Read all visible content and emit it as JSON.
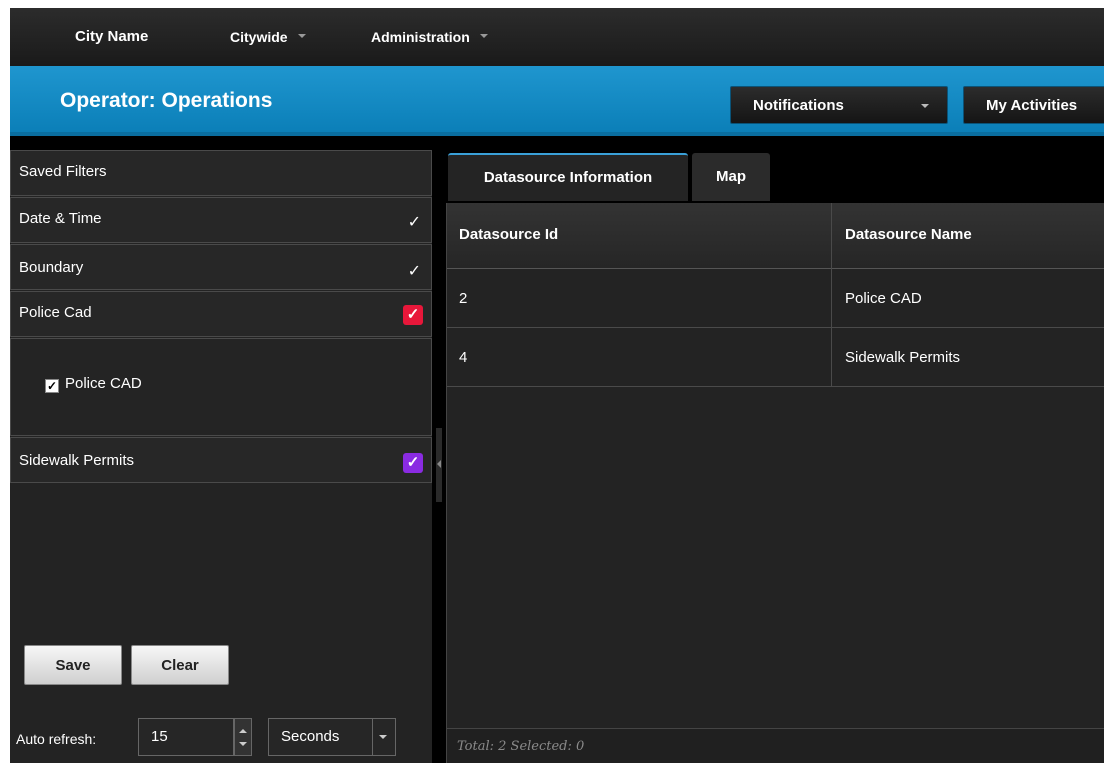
{
  "topnav": {
    "brand": "City Name",
    "menus": [
      "Citywide",
      "Administration"
    ]
  },
  "header": {
    "title": "Operator: Operations",
    "notifications_label": "Notifications",
    "activities_label": "My Activities"
  },
  "filters": {
    "saved_filters_label": "Saved Filters",
    "items": [
      {
        "label": "Date & Time",
        "checked": true
      },
      {
        "label": "Boundary",
        "checked": true
      },
      {
        "label": "Police Cad",
        "checked": true,
        "color": "#e8173a"
      },
      {
        "label": "Sidewalk Permits",
        "checked": true,
        "color": "#8a2be2"
      }
    ],
    "police_sub_option": "Police CAD",
    "check_glyph": "✓",
    "save_label": "Save",
    "clear_label": "Clear",
    "auto_refresh_label": "Auto refresh:",
    "auto_refresh_value": "15",
    "auto_refresh_unit": "Seconds"
  },
  "tabs": [
    "Datasource Information",
    "Map"
  ],
  "table": {
    "columns": [
      "Datasource Id",
      "Datasource Name"
    ],
    "rows": [
      {
        "id": "2",
        "name": "Police CAD"
      },
      {
        "id": "4",
        "name": "Sidewalk Permits"
      }
    ],
    "footer": "Total: 2 Selected: 0"
  },
  "colors": {
    "accent_blue": "#1f96cf",
    "police_red": "#e8173a",
    "sidewalk_purple": "#8a2be2"
  }
}
